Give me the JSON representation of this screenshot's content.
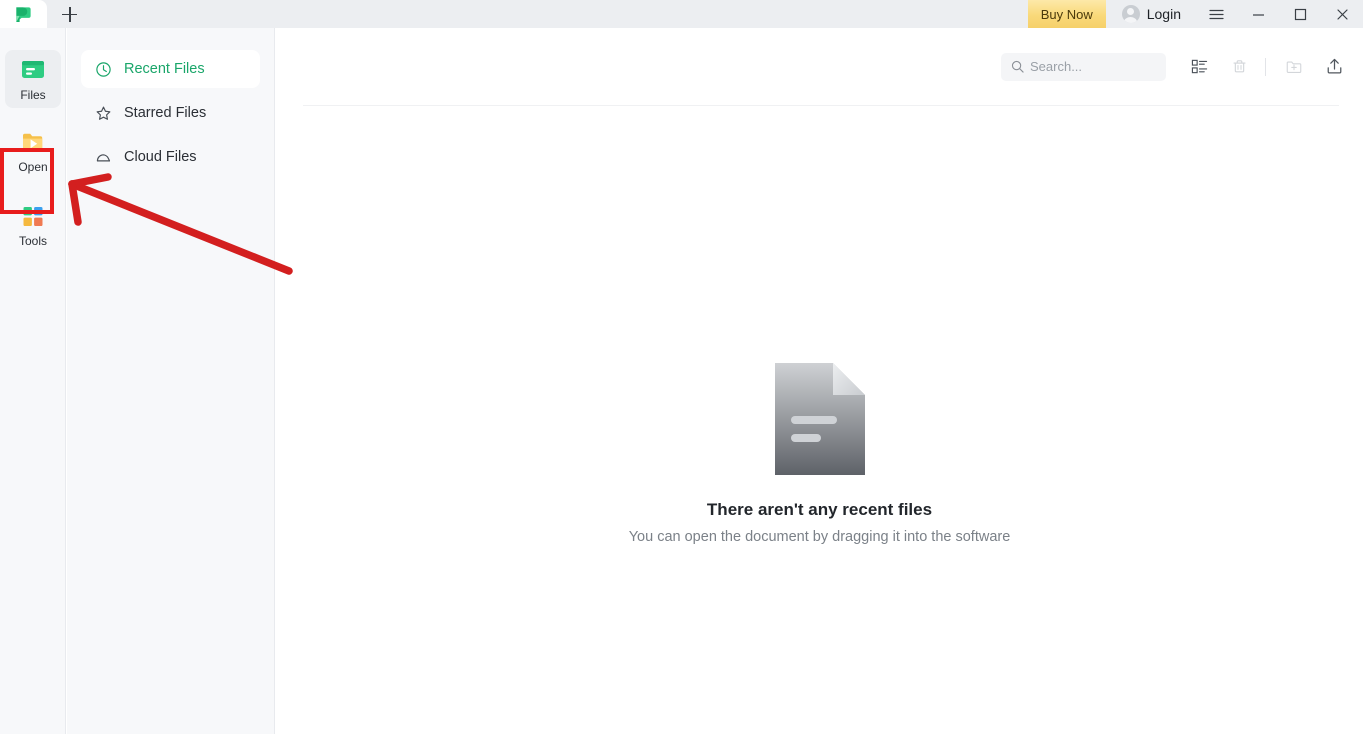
{
  "titlebar": {
    "logo_icon": "app-logo-green-speech-bubble",
    "new_tab_icon": "plus-icon",
    "buy_now_label": "Buy Now",
    "login_label": "Login",
    "avatar_icon": "user-avatar-icon",
    "menu_icon": "hamburger-menu-icon",
    "minimize_icon": "minimize-icon",
    "maximize_icon": "maximize-icon",
    "close_icon": "close-icon"
  },
  "rail": {
    "items": [
      {
        "label": "Files",
        "icon": "files-icon",
        "selected": true,
        "highlighted": false
      },
      {
        "label": "Open",
        "icon": "open-folder-play-icon",
        "selected": false,
        "highlighted": true
      },
      {
        "label": "Tools",
        "icon": "tools-grid-icon",
        "selected": false,
        "highlighted": false
      }
    ]
  },
  "sidenav": {
    "items": [
      {
        "label": "Recent Files",
        "icon": "clock-icon",
        "active": true
      },
      {
        "label": "Starred Files",
        "icon": "star-icon",
        "active": false
      },
      {
        "label": "Cloud Files",
        "icon": "cloud-icon",
        "active": false
      }
    ]
  },
  "toolbar": {
    "search_placeholder": "Search...",
    "search_value": "",
    "search_icon": "search-icon",
    "view_toggle_icon": "list-view-icon",
    "delete_icon": "trash-icon",
    "new_folder_icon": "new-folder-icon",
    "upload_icon": "upload-icon"
  },
  "empty_state": {
    "icon": "document-placeholder-icon",
    "title": "There aren't any recent files",
    "subtitle": "You can open the document by dragging it into the software"
  },
  "annotation": {
    "highlight_color": "#e81c1c",
    "arrow_color": "#d31f1f",
    "target": "Open"
  },
  "colors": {
    "accent_green": "#1aa66a",
    "titlebar_bg": "#eceef1",
    "sidebar_bg": "#f7f8fa",
    "content_bg": "#ffffff",
    "buy_now_gold": "#f6d06a"
  }
}
